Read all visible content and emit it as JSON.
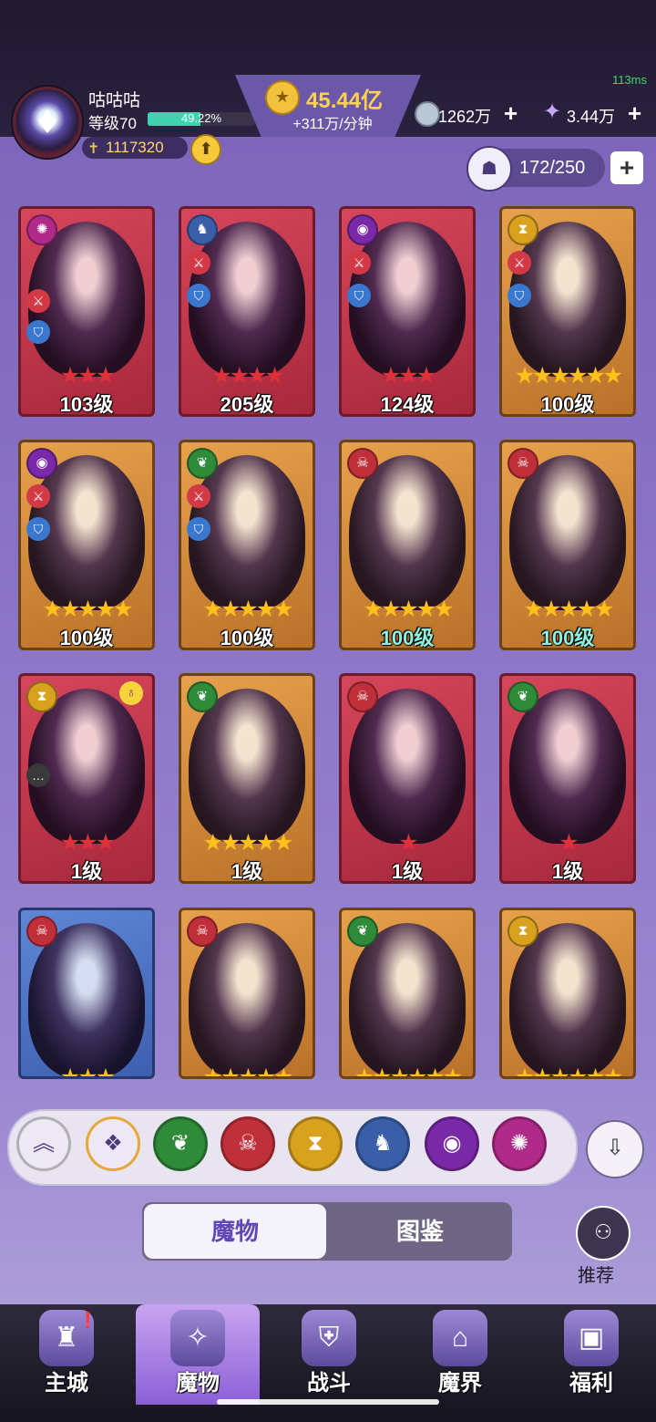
{
  "network": {
    "ping": "113ms"
  },
  "player": {
    "name": "咕咕咕",
    "level_label": "等级70",
    "xp_percent": "49.22%",
    "xp_fraction": 0.4922,
    "power": "1117320"
  },
  "currency": {
    "gold": "45.44亿",
    "gold_rate": "+311万/分钟",
    "res1": "1262万",
    "res2": "3.44万",
    "plus": "+"
  },
  "capacity": {
    "value": "172/250",
    "plus": "+"
  },
  "cards": [
    {
      "level": "103级",
      "stars": 3,
      "color": "red",
      "faction": "swirl"
    },
    {
      "level": "205级",
      "stars": 4,
      "color": "red",
      "faction": "dragon"
    },
    {
      "level": "124级",
      "stars": 3,
      "color": "red",
      "faction": "eye"
    },
    {
      "level": "100级",
      "stars": 6,
      "color": "gold",
      "faction": "hourglass"
    },
    {
      "level": "100级",
      "stars": 5,
      "color": "gold",
      "faction": "eye"
    },
    {
      "level": "100级",
      "stars": 5,
      "color": "gold",
      "faction": "leaf"
    },
    {
      "level": "100级",
      "stars": 5,
      "color": "gold",
      "faction": "demon"
    },
    {
      "level": "100级",
      "stars": 5,
      "color": "gold",
      "faction": "demon"
    },
    {
      "level": "1级",
      "stars": 3,
      "color": "red",
      "faction": "hourglass"
    },
    {
      "level": "1级",
      "stars": 5,
      "color": "gold",
      "faction": "leaf"
    },
    {
      "level": "1级",
      "stars": 1,
      "color": "red",
      "faction": "demon"
    },
    {
      "level": "1级",
      "stars": 1,
      "color": "red",
      "faction": "leaf"
    },
    {
      "level": "",
      "stars": 3,
      "color": "blue",
      "faction": "demon"
    },
    {
      "level": "",
      "stars": 5,
      "color": "gold",
      "faction": "demon"
    },
    {
      "level": "",
      "stars": 6,
      "color": "gold",
      "faction": "leaf"
    },
    {
      "level": "",
      "stars": 6,
      "color": "gold",
      "faction": "hourglass"
    }
  ],
  "card_small_labels": {
    "portrait_level_1": "1级",
    "portrait_level_2": "103级"
  },
  "filters": [
    {
      "name": "collapse",
      "icon": "chevron-up-icon",
      "color": "#ece8f4"
    },
    {
      "name": "all",
      "icon": "diamond-grid-icon",
      "color": "#ece8f4"
    },
    {
      "name": "nature",
      "icon": "leaf-icon",
      "color": "#2f8a3a"
    },
    {
      "name": "demon",
      "icon": "demon-mask-icon",
      "color": "#c0303a"
    },
    {
      "name": "time",
      "icon": "hourglass-icon",
      "color": "#d8a21e"
    },
    {
      "name": "dragon",
      "icon": "dragon-icon",
      "color": "#3a5fa8"
    },
    {
      "name": "eye",
      "icon": "eye-icon",
      "color": "#7a2aa8"
    },
    {
      "name": "void",
      "icon": "swirl-icon",
      "color": "#b02a8a"
    }
  ],
  "tabs": {
    "monster": "魔物",
    "codex": "图鉴"
  },
  "recommend": "推荐",
  "nav": [
    {
      "label": "主城",
      "icon": "castle-icon"
    },
    {
      "label": "魔物",
      "icon": "flame-crystal-icon"
    },
    {
      "label": "战斗",
      "icon": "shield-sword-icon"
    },
    {
      "label": "魔界",
      "icon": "portal-icon"
    },
    {
      "label": "福利",
      "icon": "treasure-chest-icon"
    }
  ],
  "colors": {
    "gold": "#ffd34e",
    "xp": "#3fd1b0",
    "accent": "#6046b8",
    "star_red": "#e0303a",
    "star_gold": "#ffc21a"
  }
}
